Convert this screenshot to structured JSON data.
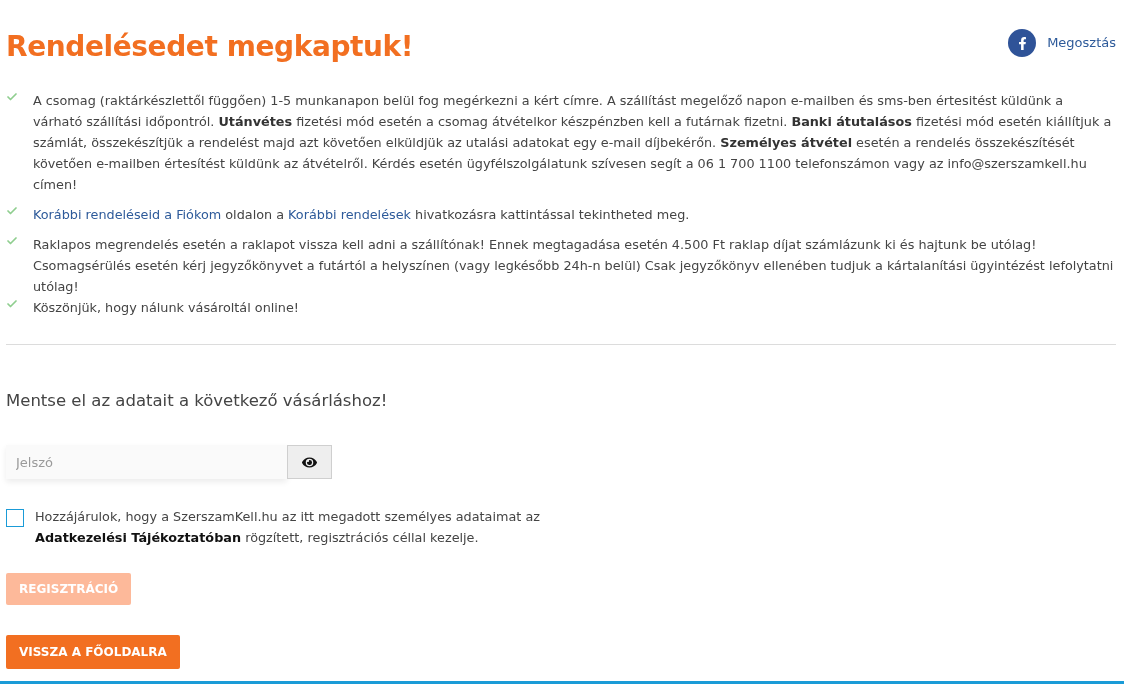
{
  "header": {
    "title": "Rendelésedet megkaptuk!",
    "share": {
      "label": "Megosztás"
    }
  },
  "info_list": [
    {
      "paragraphs": [
        [
          {
            "kind": "text",
            "text": "A csomag (raktárkészlettől függően) 1-5 munkanapon belül fog megérkezni a kért címre. A szállítást megelőző napon e-mailben és sms-ben értesitést küldünk a várható szállítási időpontról. "
          },
          {
            "kind": "bold",
            "text": "Utánvétes"
          },
          {
            "kind": "text",
            "text": " fizetési mód esetén a csomag átvételkor készpénzben kell a futárnak fizetni. "
          },
          {
            "kind": "bold",
            "text": "Banki átutalásos"
          },
          {
            "kind": "text",
            "text": " fizetési mód esetén kiállítjuk a számlát, összekészítjük a rendelést majd azt követően elküldjük az utalási adatokat egy e-mail díjbekérőn. "
          },
          {
            "kind": "bold",
            "text": "Személyes átvétel"
          },
          {
            "kind": "text",
            "text": " esetén a rendelés összekészítését követően e-mailben értesítést küldünk az átvételről. Kérdés esetén ügyfélszolgálatunk szívesen segít a 06 1 700 1100 telefonszámon vagy az info@szerszamkell.hu címen!"
          }
        ]
      ]
    },
    {
      "paragraphs": [
        [
          {
            "kind": "link",
            "text": "Korábbi rendeléseid a Fiókom"
          },
          {
            "kind": "text",
            "text": " oldalon a "
          },
          {
            "kind": "link",
            "text": "Korábbi rendelések"
          },
          {
            "kind": "text",
            "text": " hivatkozásra kattintással tekintheted meg."
          }
        ]
      ]
    },
    {
      "paragraphs": [
        [
          {
            "kind": "text",
            "text": "Raklapos megrendelés esetén a raklapot vissza kell adni a szállítónak! Ennek megtagadása esetén 4.500 Ft raklap díjat számlázunk ki és hajtunk be utólag!"
          }
        ],
        [
          {
            "kind": "text",
            "text": "Csomagsérülés esetén kérj jegyzőkönyvet a futártól a helyszínen (vagy legkésőbb 24h-n belül) Csak jegyzőkönyv ellenében tudjuk a kártalanítási ügyintézést lefolytatni utólag!"
          }
        ]
      ]
    },
    {
      "paragraphs": [
        [
          {
            "kind": "text",
            "text": "Köszönjük, hogy nálunk vásároltál online!"
          }
        ]
      ]
    }
  ],
  "register": {
    "heading": "Mentse el az adatait a következő vásárláshoz!",
    "password": {
      "placeholder": "Jelszó"
    },
    "consent": {
      "checked": false,
      "segments": [
        {
          "kind": "text",
          "text": "Hozzájárulok, hogy a SzerszamKell.hu az itt megadott személyes adataimat az "
        },
        {
          "kind": "bold",
          "text": "Adatkezelési Tájékoztatóban"
        },
        {
          "kind": "text",
          "text": " rögzített, regisztrációs céllal kezelje."
        }
      ]
    },
    "button": {
      "label": "REGISZTRÁCIÓ",
      "disabled": true
    }
  },
  "back_button": {
    "label": "VISSZA A FŐOLDALRA"
  }
}
